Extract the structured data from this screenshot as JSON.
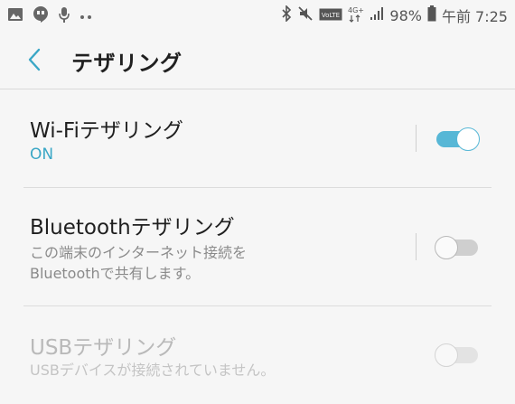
{
  "statusbar": {
    "left_icons": [
      "image-icon",
      "hangouts-icon",
      "microphone-icon",
      "more-dots-icon"
    ],
    "right_icons": [
      "bluetooth-icon",
      "mute-icon",
      "volte-icon",
      "4g-icon",
      "signal-icon",
      "battery-icon"
    ],
    "network": "4G+",
    "volte": "VoLTE",
    "battery": "98%",
    "time": "午前 7:25"
  },
  "header": {
    "title": "テザリング"
  },
  "settings": [
    {
      "title": "Wi-Fiテザリング",
      "subtitle": "ON",
      "enabled": true,
      "toggle_on": true
    },
    {
      "title": "Bluetoothテザリング",
      "subtitle_line1": "この端末のインターネット接続を",
      "subtitle_line2": "Bluetoothで共有します。",
      "enabled": true,
      "toggle_on": false
    },
    {
      "title": "USBテザリング",
      "subtitle": "USBデバイスが接続されていません。",
      "enabled": false,
      "toggle_on": false
    }
  ],
  "colors": {
    "accent": "#57b7d6",
    "on_text": "#3aa7c6",
    "background": "#f6f6f6"
  }
}
